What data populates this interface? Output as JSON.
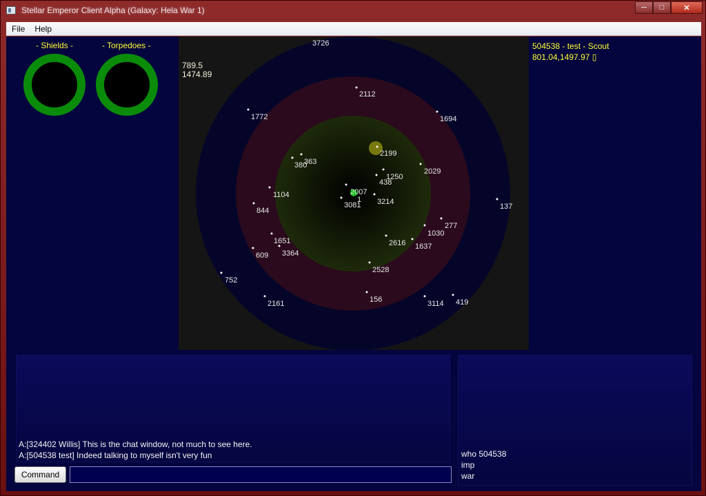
{
  "window": {
    "title": "Stellar Emperor Client Alpha (Galaxy: Hela War 1)",
    "controls": [
      "minimize",
      "maximize",
      "close"
    ]
  },
  "menu": {
    "items": [
      "File",
      "Help"
    ]
  },
  "gauges": {
    "shields_label": "- Shields -",
    "torpedoes_label": "- Torpedoes -",
    "ring_color": "#0a8c0a"
  },
  "radar": {
    "coords": [
      "789.5",
      "1474.89"
    ],
    "zone_colors": {
      "outer": "#05052a",
      "middle": "#2a0a1c",
      "inner": "#1e2a0a"
    },
    "contacts": [
      "3726",
      "2112",
      "1772",
      "1694",
      "2199",
      "380",
      "363",
      "2029",
      "1250",
      "438",
      "1104",
      "2007",
      "1",
      "3081",
      "3214",
      "844",
      "137",
      "277",
      "1030",
      "1651",
      "2616",
      "1637",
      "609",
      "3364",
      "2528",
      "752",
      "156",
      "2161",
      "3114",
      "419"
    ]
  },
  "ship": {
    "header": "504538 - test - Scout",
    "position": "801.04,1497.97 ▯"
  },
  "chat": {
    "messages": [
      "A:[324402 Willis] This is the chat window, not much to see here.",
      "A:[504538 test] Indeed talking to myself isn't very fun"
    ]
  },
  "command_history": [
    "who 504538",
    "imp",
    "war"
  ],
  "command_bar": {
    "button_label": "Command",
    "input_value": ""
  }
}
